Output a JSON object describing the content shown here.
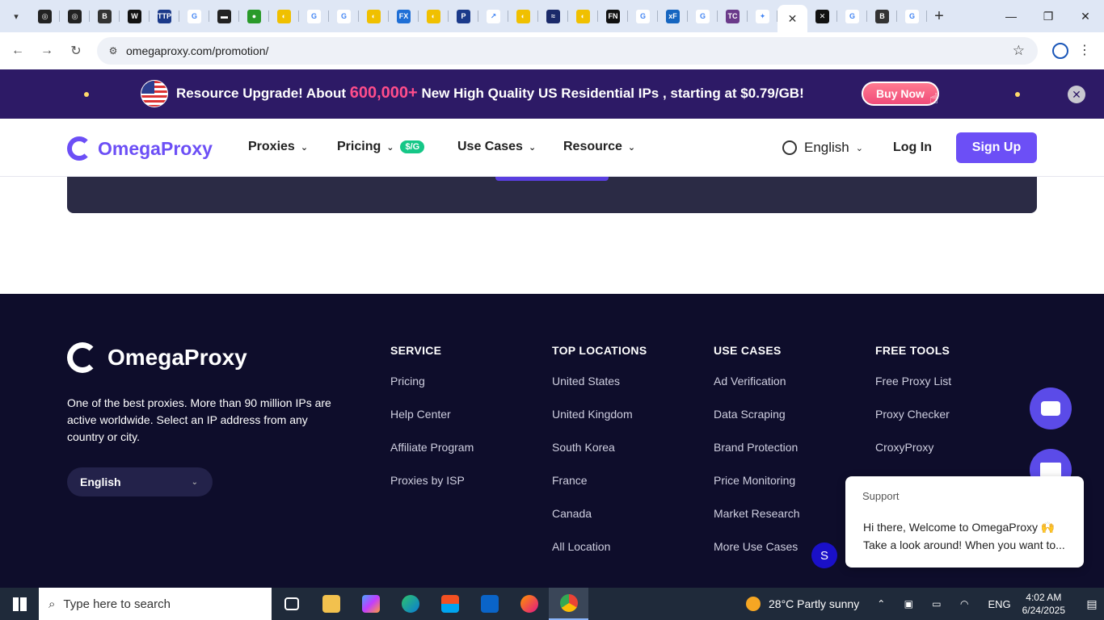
{
  "browser": {
    "tabs": [
      {
        "icon": "openai-icon",
        "bg": "#222",
        "glyph": "◎"
      },
      {
        "icon": "openai-icon",
        "bg": "#222",
        "glyph": "◎"
      },
      {
        "icon": "b-icon",
        "bg": "#333",
        "glyph": "B"
      },
      {
        "icon": "w-icon",
        "bg": "#111",
        "glyph": "W"
      },
      {
        "icon": "ttp-icon",
        "bg": "#1b3a8a",
        "glyph": "TTP"
      },
      {
        "icon": "google-icon",
        "bg": "#ffffff",
        "glyph": "G"
      },
      {
        "icon": "film-icon",
        "bg": "#222",
        "glyph": "▬"
      },
      {
        "icon": "green-icon",
        "bg": "#2a9a2a",
        "glyph": "●"
      },
      {
        "icon": "yellow-icon",
        "bg": "#f0c000",
        "glyph": "◐"
      },
      {
        "icon": "google-icon",
        "bg": "#ffffff",
        "glyph": "G"
      },
      {
        "icon": "google-icon",
        "bg": "#ffffff",
        "glyph": "G"
      },
      {
        "icon": "yellow-icon",
        "bg": "#f0c000",
        "glyph": "◐"
      },
      {
        "icon": "fx-icon",
        "bg": "#1f6fd6",
        "glyph": "FX"
      },
      {
        "icon": "yellow-icon",
        "bg": "#f0c000",
        "glyph": "◐"
      },
      {
        "icon": "p-icon",
        "bg": "#1b3a8a",
        "glyph": "P"
      },
      {
        "icon": "chart-icon",
        "bg": "#ffffff",
        "glyph": "↗"
      },
      {
        "icon": "yellow-icon",
        "bg": "#f0c000",
        "glyph": "◐"
      },
      {
        "icon": "wave-icon",
        "bg": "#1b2a6a",
        "glyph": "≈"
      },
      {
        "icon": "yellow-icon",
        "bg": "#f0c000",
        "glyph": "◐"
      },
      {
        "icon": "fn-icon",
        "bg": "#111",
        "glyph": "FN"
      },
      {
        "icon": "google-icon",
        "bg": "#ffffff",
        "glyph": "G"
      },
      {
        "icon": "xf-icon",
        "bg": "#1565c0",
        "glyph": "xF"
      },
      {
        "icon": "google-icon",
        "bg": "#ffffff",
        "glyph": "G"
      },
      {
        "icon": "tc-icon",
        "bg": "#6a3a8a",
        "glyph": "TC"
      },
      {
        "icon": "gemini-icon",
        "bg": "#ffffff",
        "glyph": "✦"
      },
      {
        "icon": "close-icon",
        "bg": "transparent",
        "glyph": "✕",
        "active": true
      },
      {
        "icon": "x-icon",
        "bg": "#111",
        "glyph": "✕"
      },
      {
        "icon": "google-icon",
        "bg": "#ffffff",
        "glyph": "G"
      },
      {
        "icon": "b-icon",
        "bg": "#333",
        "glyph": "B"
      },
      {
        "icon": "google-icon",
        "bg": "#ffffff",
        "glyph": "G"
      }
    ],
    "url": "omegaproxy.com/promotion/"
  },
  "promo": {
    "text_before": "Resource Upgrade!  About ",
    "highlight": "600,000+",
    "text_after": " New High Quality US Residential IPs , starting at $0.79/GB!",
    "button": "Buy Now"
  },
  "nav": {
    "brand": "OmegaProxy",
    "items": [
      {
        "label": "Proxies"
      },
      {
        "label": "Pricing",
        "badge": "$/G"
      },
      {
        "label": "Use Cases"
      },
      {
        "label": "Resource"
      }
    ],
    "language": "English",
    "login": "Log In",
    "signup": "Sign Up"
  },
  "footer": {
    "brand": "OmegaProxy",
    "description": "One of the best proxies. More than 90 million IPs are active worldwide. Select an IP address from any country or city.",
    "language": "English",
    "columns": [
      {
        "title": "SERVICE",
        "links": [
          "Pricing",
          "Help Center",
          "Affiliate Program",
          "Proxies by ISP"
        ]
      },
      {
        "title": "TOP LOCATIONS",
        "links": [
          "United States",
          "United Kingdom",
          "South Korea",
          "France",
          "Canada",
          "All Location"
        ]
      },
      {
        "title": "USE CASES",
        "links": [
          "Ad Verification",
          "Data Scraping",
          "Brand Protection",
          "Price Monitoring",
          "Market Research",
          "More Use Cases"
        ]
      },
      {
        "title": "FREE TOOLS",
        "links": [
          "Free Proxy List",
          "Proxy Checker",
          "CroxyProxy"
        ]
      }
    ]
  },
  "chat": {
    "sender": "Support",
    "line1": "Hi there, Welcome to OmegaProxy 🙌",
    "line2": "Take a look around! When you want to...",
    "avatar": "S"
  },
  "taskbar": {
    "search_placeholder": "Type here to search",
    "weather": "28°C  Partly sunny",
    "lang": "ENG",
    "time": "4:02 AM",
    "date": "6/24/2025"
  }
}
